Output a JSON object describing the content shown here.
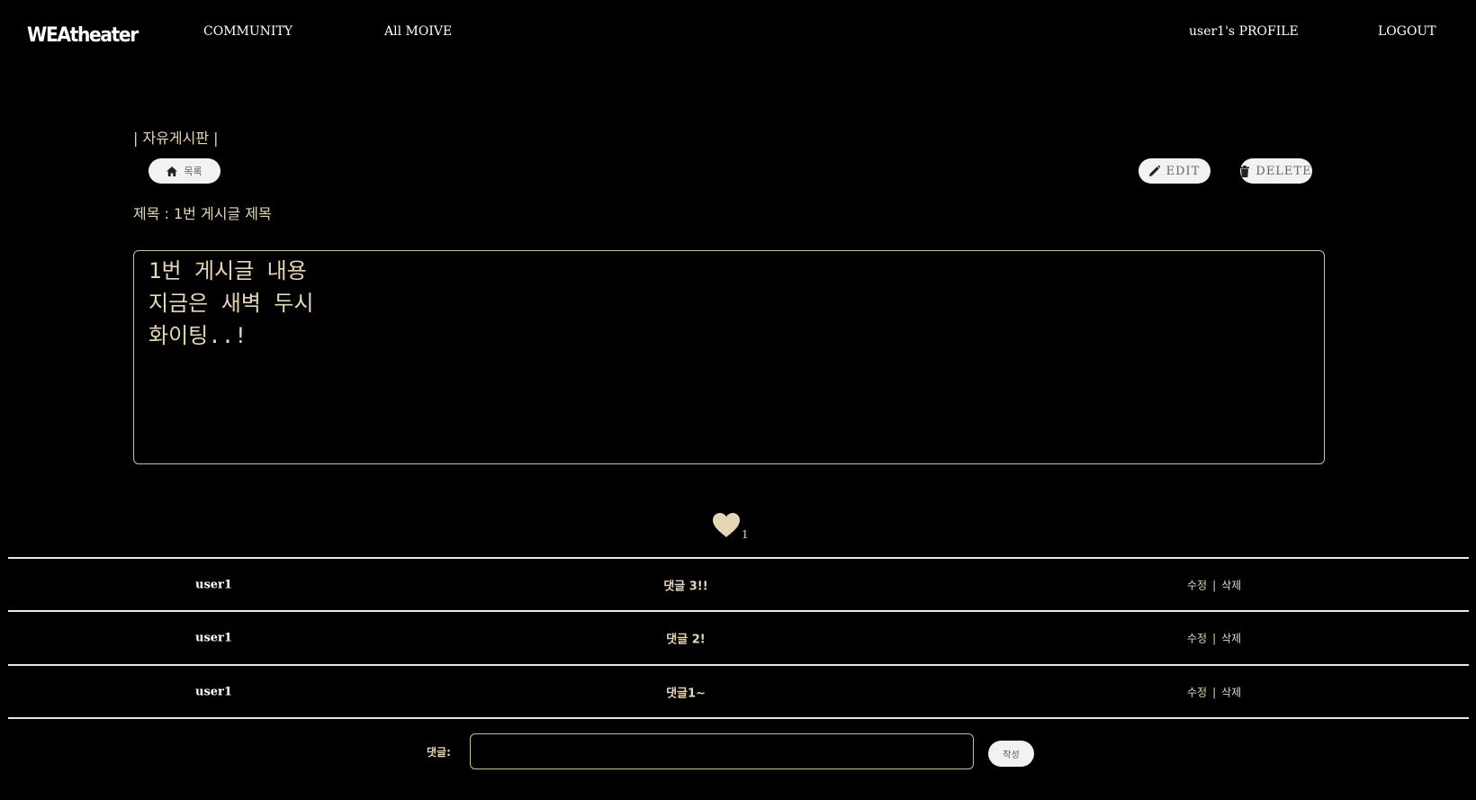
{
  "header": {
    "brand": "WEAtheater",
    "nav": {
      "community": "COMMUNITY",
      "all_movie": "All MOIVE",
      "profile": "user1's PROFILE",
      "logout": "LOGOUT"
    }
  },
  "board": {
    "title": "| 자유게시판 |",
    "list_button": "목록",
    "edit_button": "EDIT",
    "delete_button": "DELETE"
  },
  "post": {
    "title": "제목 : 1번 게시글 제목",
    "content": [
      "1번 게시글 내용",
      "지금은 새벽 두시",
      "화이팅..!"
    ],
    "likes": "1"
  },
  "comments": [
    {
      "author": "user1",
      "text": "댓글 3!!",
      "edit": "수정",
      "separator": "|",
      "delete": "삭제"
    },
    {
      "author": "user1",
      "text": "댓글 2!",
      "edit": "수정",
      "separator": "|",
      "delete": "삭제"
    },
    {
      "author": "user1",
      "text": "댓글1~",
      "edit": "수정",
      "separator": "|",
      "delete": "삭제"
    }
  ],
  "comment_form": {
    "label": "댓글:",
    "value": "",
    "submit": "작성"
  },
  "colors": {
    "background": "#000000",
    "accent": "#e6d7b4",
    "border": "#cdbf9c",
    "pill": "#f2f2f2"
  },
  "icons": {
    "list": "home-icon",
    "edit": "pencil-icon",
    "delete": "trash-icon",
    "like": "heart-icon"
  }
}
